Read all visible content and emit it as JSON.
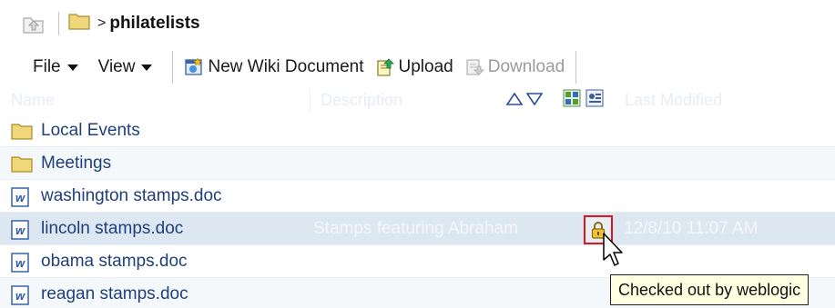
{
  "breadcrumb": {
    "path": "philatelists",
    "arrow": ">"
  },
  "toolbar": {
    "file_label": "File",
    "view_label": "View",
    "new_wiki_label": "New Wiki Document",
    "upload_label": "Upload",
    "download_label": "Download"
  },
  "columns": {
    "name": "Name",
    "description": "Description",
    "last_modified": "Last Modified"
  },
  "rows": [
    {
      "name": "Local Events",
      "icon": "folder-icon",
      "description": "",
      "modified": ""
    },
    {
      "name": "Meetings",
      "icon": "folder-icon",
      "description": "",
      "modified": ""
    },
    {
      "name": "washington stamps.doc",
      "icon": "word-doc-icon",
      "description": "",
      "modified": ""
    },
    {
      "name": "lincoln stamps.doc",
      "icon": "word-doc-icon",
      "description": "Stamps featuring Abraham",
      "modified": "12/8/10 11:07 AM",
      "selected": true,
      "locked": true
    },
    {
      "name": "obama stamps.doc",
      "icon": "word-doc-icon",
      "description": "",
      "modified": ""
    },
    {
      "name": "reagan stamps.doc",
      "icon": "word-doc-icon",
      "description": "",
      "modified": ""
    }
  ],
  "tooltip": {
    "text": "Checked out by weblogic"
  },
  "colors": {
    "link": "#1f3f7a",
    "selected_row": "#dde7f2",
    "highlight_box": "#e0141b",
    "tooltip_bg": "#ffffe1",
    "folder": "#f0d77a"
  }
}
